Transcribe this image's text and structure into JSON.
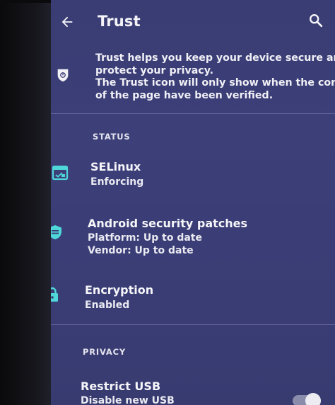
{
  "toolbar": {
    "back_icon": "arrow-back-icon",
    "title": "Trust",
    "search_icon": "search-icon"
  },
  "intro": {
    "icon": "trust-shield-icon",
    "lines": [
      "Trust helps you keep your device secure and",
      "protect your privacy.",
      "The Trust icon will only show when the contents",
      "of the page have been verified."
    ]
  },
  "status": {
    "header": "STATUS",
    "items": [
      {
        "icon": "selinux-window-icon",
        "title": "SELinux",
        "lines": [
          "Enforcing"
        ]
      },
      {
        "icon": "security-shield-icon",
        "title": "Android security patches",
        "lines": [
          "Platform: Up to date",
          "Vendor: Up to date"
        ]
      },
      {
        "icon": "lock-icon",
        "title": "Encryption",
        "lines": [
          "Enabled"
        ]
      }
    ]
  },
  "privacy": {
    "header": "PRIVACY",
    "items": [
      {
        "title": "Restrict USB",
        "lines": [
          "Disable new USB"
        ]
      }
    ]
  },
  "colors": {
    "accent_teal": "#4fd6d8",
    "screen_bg": "#3b3e76",
    "text": "#f2f2f6"
  }
}
